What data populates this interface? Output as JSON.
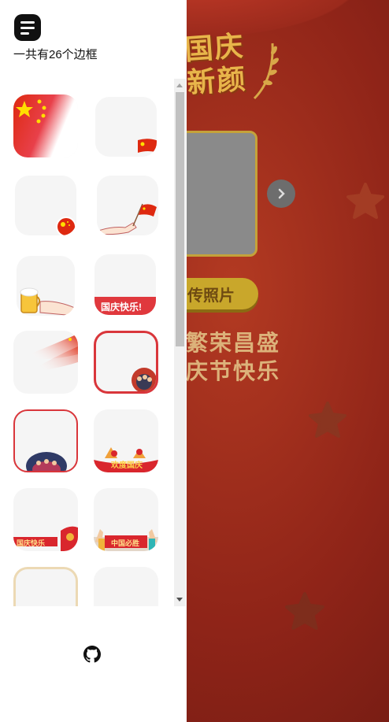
{
  "drawer": {
    "count_text": "一共有26个边框"
  },
  "frames": [
    {
      "name": "frame-national-flag-full"
    },
    {
      "name": "frame-small-flag-corner"
    },
    {
      "name": "frame-flag-badge-round"
    },
    {
      "name": "frame-hand-holding-flag"
    },
    {
      "name": "frame-beer-toast"
    },
    {
      "name": "frame-guoqing-kuaile-banner",
      "label": "国庆快乐!"
    },
    {
      "name": "frame-flying-flag-blur"
    },
    {
      "name": "frame-red-border-crowd"
    },
    {
      "name": "frame-red-border-stage"
    },
    {
      "name": "frame-huanqing-guoqing",
      "label": "欢度国庆"
    },
    {
      "name": "frame-guoqing-kuaile-corner",
      "label": "国庆快乐"
    },
    {
      "name": "frame-zhongguo-bisheng",
      "label": "中国必胜"
    },
    {
      "name": "frame-gold-border"
    },
    {
      "name": "frame-blank"
    }
  ],
  "background": {
    "title_line1": "国庆",
    "title_line2": "新颜",
    "upload_label": "传照片",
    "slogan_line1": "繁荣昌盛",
    "slogan_line2": "庆节快乐"
  },
  "icons": {
    "menu": "menu-icon",
    "next": "chevron-right-icon",
    "github": "github-icon"
  },
  "colors": {
    "bg_red": "#8f2418",
    "accent_gold": "#e8b54a",
    "flag_red": "#de2910",
    "flag_yellow": "#ffde00"
  }
}
